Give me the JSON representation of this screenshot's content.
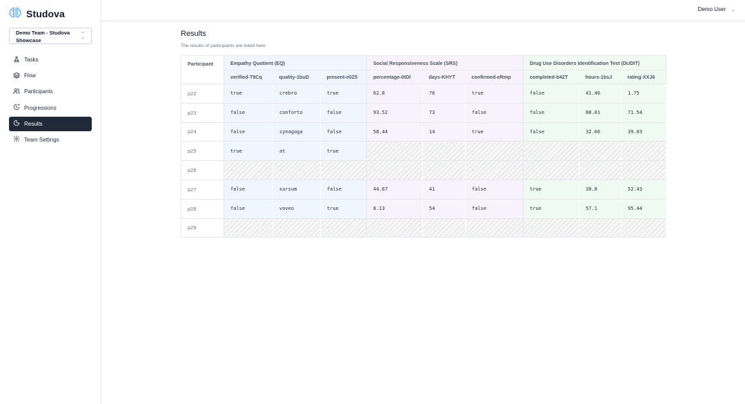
{
  "app": {
    "name": "Studova"
  },
  "team": {
    "name": "Demo Team - Studova Showcase"
  },
  "nav": [
    {
      "label": "Tasks",
      "icon": "flask-icon",
      "active": false
    },
    {
      "label": "Flow",
      "icon": "layers-icon",
      "active": false
    },
    {
      "label": "Participants",
      "icon": "users-icon",
      "active": false
    },
    {
      "label": "Progressions",
      "icon": "progress-icon",
      "active": false
    },
    {
      "label": "Results",
      "icon": "results-icon",
      "active": true
    },
    {
      "label": "Team Settings",
      "icon": "gear-icon",
      "active": false
    }
  ],
  "user": {
    "name": "Demo User"
  },
  "page": {
    "title": "Results",
    "subtitle": "The results of participants are listed here."
  },
  "table": {
    "participant_header": "Participant",
    "groups": [
      {
        "name": "Empathy Quotient (EQ)",
        "class": "eq",
        "columns": [
          "verified-T9Cq",
          "quality-1buD",
          "present-e0Z5"
        ]
      },
      {
        "name": "Social Responsiveness Scale (SRS)",
        "class": "srs",
        "columns": [
          "percentage-0tDl",
          "days-KHYT",
          "confirmed-eRmp"
        ]
      },
      {
        "name": "Drug Use Disorders Identification Test (DUDIT)",
        "class": "dudit",
        "columns": [
          "completed-b42T",
          "hours-1bsJ",
          "rating-XXJ6"
        ]
      }
    ],
    "empty_marker": "-",
    "rows": [
      {
        "id": "p22",
        "cells": [
          "true",
          "crebro",
          "true",
          "62.8",
          "76",
          "true",
          "false",
          "41.46",
          "1.75"
        ]
      },
      {
        "id": "p23",
        "cells": [
          "false",
          "conforto",
          "false",
          "93.52",
          "73",
          "false",
          "false",
          "88.01",
          "71.54"
        ]
      },
      {
        "id": "p24",
        "cells": [
          "false",
          "synagoga",
          "false",
          "58.44",
          "14",
          "true",
          "false",
          "32.66",
          "39.03"
        ]
      },
      {
        "id": "p25",
        "cells": [
          "true",
          "at",
          "true",
          null,
          null,
          null,
          null,
          null,
          null
        ]
      },
      {
        "id": "p26",
        "cells": [
          null,
          null,
          null,
          null,
          null,
          null,
          null,
          null,
          null
        ]
      },
      {
        "id": "p27",
        "cells": [
          "false",
          "sursum",
          "false",
          "44.67",
          "41",
          "false",
          "true",
          "30.8",
          "52.43"
        ]
      },
      {
        "id": "p28",
        "cells": [
          "false",
          "voveo",
          "true",
          "8.13",
          "54",
          "false",
          "true",
          "57.1",
          "95.44"
        ]
      },
      {
        "id": "p29",
        "cells": [
          null,
          null,
          null,
          null,
          null,
          null,
          null,
          null,
          null
        ]
      }
    ]
  }
}
